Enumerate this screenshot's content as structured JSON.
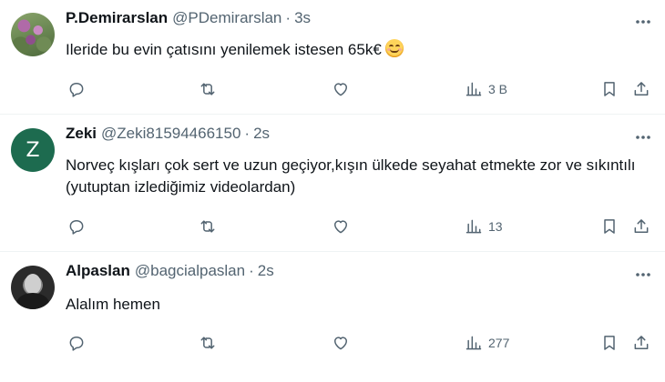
{
  "tweets": [
    {
      "display_name": "P.Demirarslan",
      "handle": "@PDemirarslan",
      "time": "3s",
      "text": "Ileride bu evin çatısını yenilemek istesen 65k€",
      "has_emoji": true,
      "views": "3 B",
      "avatar": "flowers-photo"
    },
    {
      "display_name": "Zeki",
      "handle": "@Zeki81594466150",
      "time": "2s",
      "text": "Norveç kışları çok sert ve uzun  geçiyor,kışın ülkede seyahat etmekte zor ve sıkıntılı (yutuptan izlediğimiz videolardan)",
      "avatar_letter": "Z",
      "views": "13"
    },
    {
      "display_name": "Alpaslan",
      "handle": "@bagcialpaslan",
      "time": "2s",
      "text": "Alalım hemen",
      "views": "277",
      "avatar": "portrait-photo"
    }
  ],
  "separator": "·",
  "colors": {
    "text_primary": "#0f1419",
    "text_secondary": "#536471",
    "divider": "#eff3f4",
    "avatar_z_bg": "#1d6b4f"
  }
}
